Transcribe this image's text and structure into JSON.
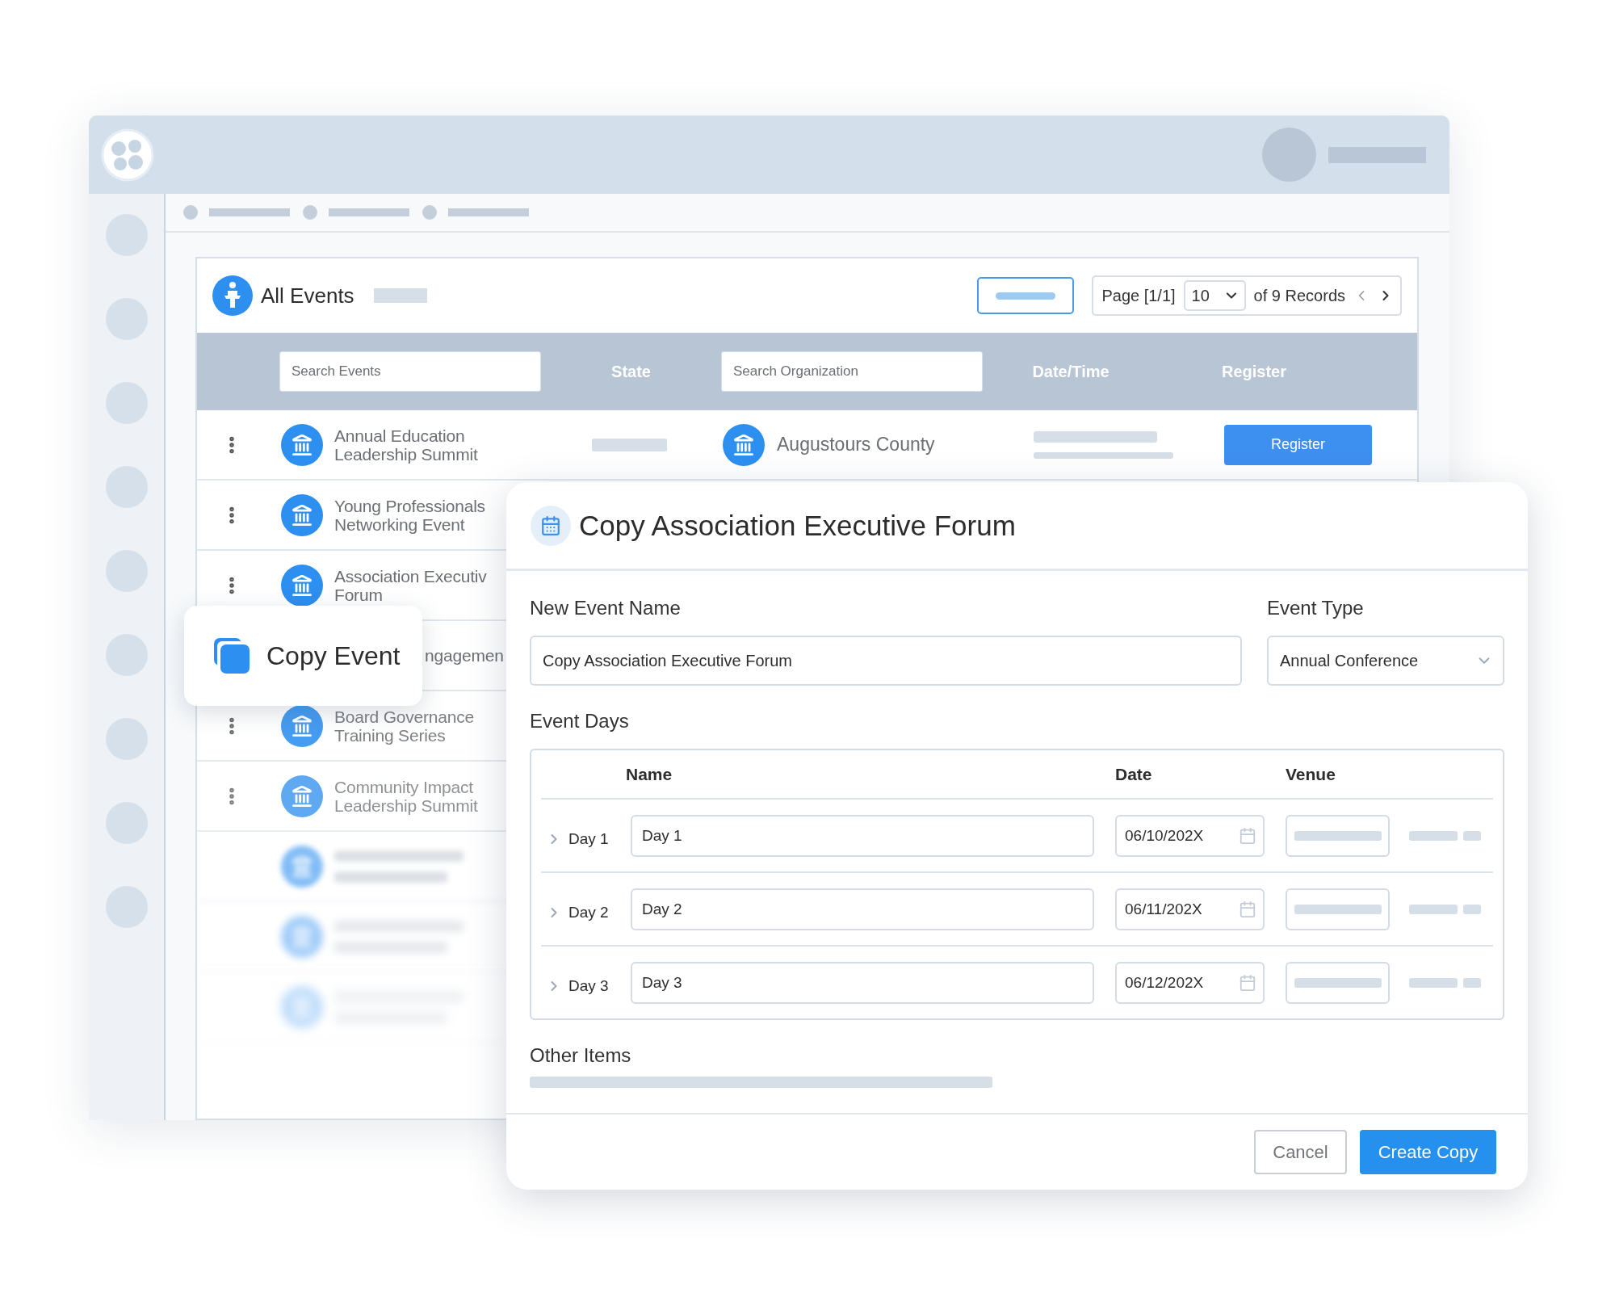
{
  "events_panel": {
    "title": "All Events",
    "pagination": {
      "page": "Page [1/1]",
      "page_size": "10",
      "records": "of 9 Records"
    },
    "columns": {
      "search_events": {
        "placeholder": "Search Events"
      },
      "state": "State",
      "search_organization": {
        "placeholder": "Search Organization"
      },
      "date_time": "Date/Time",
      "register": "Register"
    },
    "rows": [
      {
        "kind": "full",
        "name_lines": [
          "Annual Education",
          "Leadership Summit"
        ],
        "organization": "Augustours County",
        "register": "Register"
      },
      {
        "kind": "covered",
        "name_lines": [
          "Young Professionals",
          "Networking Event"
        ]
      },
      {
        "kind": "covered",
        "name_lines": [
          "Association Executiv",
          "Forum"
        ]
      },
      {
        "kind": "partial",
        "name_lines": [
          "ngagemen"
        ]
      },
      {
        "kind": "covered",
        "name_lines": [
          "Board Governance",
          "Training Series"
        ]
      },
      {
        "kind": "covered",
        "name_lines": [
          "Community Impact",
          "Leadership Summit"
        ]
      },
      {
        "kind": "skeleton"
      },
      {
        "kind": "skeleton"
      },
      {
        "kind": "skeleton"
      }
    ]
  },
  "context_menu": {
    "label": "Copy Event"
  },
  "dialog": {
    "title": "Copy Association Executive Forum",
    "new_event_name": {
      "label": "New Event Name",
      "value": "Copy Association Executive Forum"
    },
    "event_type": {
      "label": "Event Type",
      "value": "Annual Conference"
    },
    "event_days": {
      "label": "Event Days",
      "columns": [
        "Name",
        "Date",
        "Venue"
      ],
      "days": [
        {
          "label": "Day 1",
          "expanded": false,
          "name": "Day 1",
          "date": "06/10/202X"
        },
        {
          "label": "Day 2",
          "expanded": false,
          "name": "Day 2",
          "date": "06/11/202X"
        },
        {
          "label": "Day 3",
          "expanded": false,
          "name": "Day 3",
          "date": "06/12/202X"
        }
      ]
    },
    "other_items": {
      "label": "Other Items"
    },
    "buttons": {
      "cancel": "Cancel",
      "create": "Create Copy"
    }
  }
}
